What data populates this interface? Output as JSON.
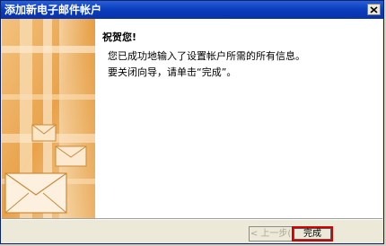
{
  "window": {
    "title": "添加新电子邮件帐户",
    "close_label": "×"
  },
  "message": {
    "welcome": "祝贺您!",
    "line1": "您已成功地输入了设置帐户所需的所有信息。",
    "line2": "要关闭向导，请单击“完成”。"
  },
  "buttons": {
    "back": "< 上一步(B)",
    "finish": "完成"
  },
  "colors": {
    "titlebar": "#0b3fbf",
    "highlight": "#d40000",
    "art_orange": "#e8a040"
  }
}
